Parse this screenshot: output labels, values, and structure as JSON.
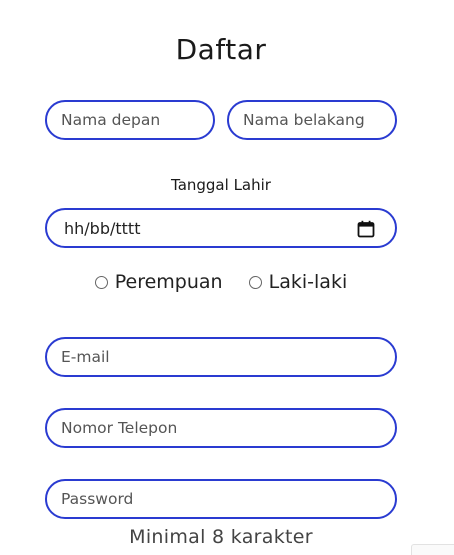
{
  "form": {
    "title": "Daftar",
    "first_name_placeholder": "Nama depan",
    "last_name_placeholder": "Nama belakang",
    "dob_label": "Tanggal Lahir",
    "dob_value": "hh/bb/tttt",
    "gender_options": [
      {
        "label": "Perempuan"
      },
      {
        "label": "Laki-laki"
      }
    ],
    "email_placeholder": "E-mail",
    "phone_placeholder": "Nomor Telepon",
    "password_placeholder": "Password",
    "password_hint": "Minimal 8 karakter"
  },
  "colors": {
    "input_border": "#2a3bd1"
  },
  "icons": {
    "date": "calendar-icon"
  }
}
